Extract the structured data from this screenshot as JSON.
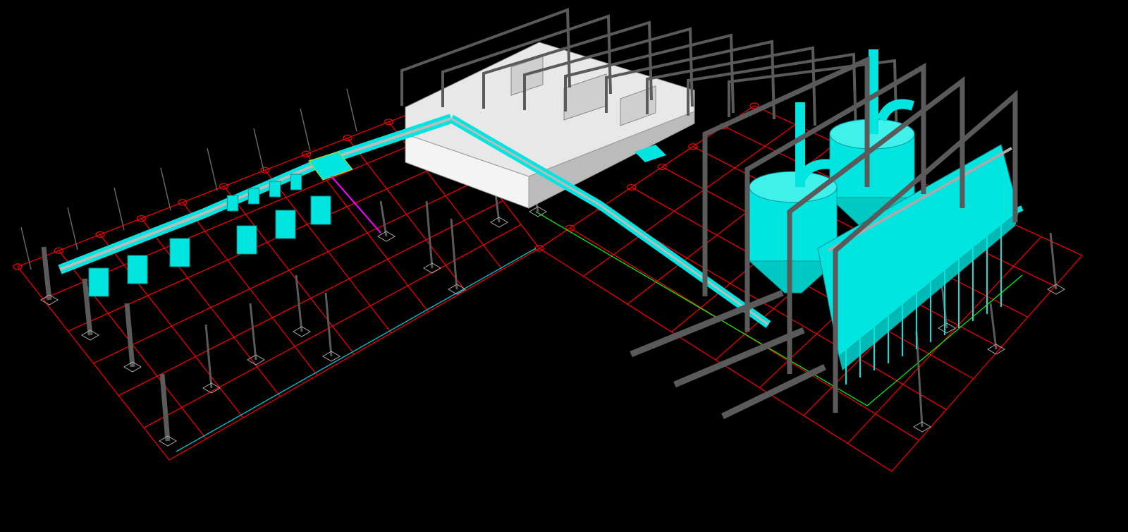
{
  "viewport": {
    "background_color": "#000000",
    "colors": {
      "grid": "#ff0000",
      "equipment": "#00e5e0",
      "steel_frame": "#5a5a5a",
      "building": "#e8e8e8",
      "boundary_line": "#00c8d8",
      "accent_magenta": "#ff00ff",
      "accent_green": "#00ff00",
      "accent_yellow": "#e0d000"
    }
  }
}
